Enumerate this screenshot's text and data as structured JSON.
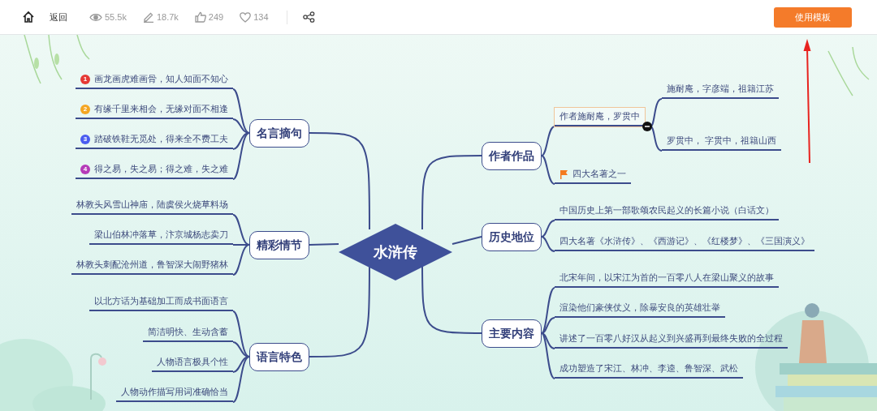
{
  "toolbar": {
    "back": "返回",
    "stats": [
      {
        "kind": "views",
        "value": "55.5k"
      },
      {
        "kind": "edits",
        "value": "18.7k"
      },
      {
        "kind": "likes",
        "value": "249"
      },
      {
        "kind": "favorites",
        "value": "134"
      }
    ],
    "button": "使用模板"
  },
  "mindmap": {
    "root": "水浒传",
    "branches": [
      {
        "title": "名言摘句",
        "children": [
          {
            "text": "画龙画虎难画骨，知人知面不知心",
            "marker": "1",
            "color": "#e53935",
            "selected": false
          },
          {
            "text": "有缘千里来相会，无缘对面不相逢",
            "marker": "2",
            "color": "#f5a623",
            "selected": false
          },
          {
            "text": "踏破铁鞋无觅处，得来全不费工夫",
            "marker": "3",
            "color": "#4a5cf0",
            "selected": false
          },
          {
            "text": "得之易，失之易；得之难，失之难",
            "marker": "4",
            "color": "#b53bb8",
            "selected": false
          }
        ]
      },
      {
        "title": "精彩情节",
        "children": [
          {
            "text": "林教头风雪山神庙，陆虞侯火烧草料场",
            "selected": false
          },
          {
            "text": "梁山伯林冲落草，汴京城杨志卖刀",
            "selected": false
          },
          {
            "text": "林教头刺配沧州道，鲁智深大闹野猪林",
            "selected": false
          }
        ]
      },
      {
        "title": "语言特色",
        "children": [
          {
            "text": "以北方话为基础加工而成书面语言",
            "selected": false
          },
          {
            "text": "简洁明快、生动含蓄",
            "selected": false
          },
          {
            "text": "人物语言极具个性",
            "selected": false
          },
          {
            "text": "人物动作描写用词准确恰当",
            "selected": false
          }
        ]
      },
      {
        "title": "作者作品",
        "children": [
          {
            "text": "作者施耐庵，罗贯中",
            "selected": true,
            "expanded": true,
            "children": [
              {
                "text": "施耐庵，字彦端，祖籍江苏",
                "selected": false
              },
              {
                "text": "罗贯中， 字贯中，祖籍山西",
                "selected": false
              }
            ]
          },
          {
            "text": "四大名著之一",
            "kind": "flag",
            "selected": false
          }
        ]
      },
      {
        "title": "历史地位",
        "children": [
          {
            "text": "中国历史上第一部歌颂农民起义的长篇小说（白话文）",
            "selected": false
          },
          {
            "text": "四大名著《水浒传》、《西游记》、《红楼梦》、《三国演义》",
            "selected": false
          }
        ]
      },
      {
        "title": "主要内容",
        "children": [
          {
            "text": "北宋年间，以宋江为首的一百零八人在梁山聚义的故事",
            "selected": false
          },
          {
            "text": "渲染他们豪侠仗义，除暴安良的英雄壮举",
            "selected": false
          },
          {
            "text": "讲述了一百零八好汉从起义到兴盛再到最终失败的全过程",
            "selected": false
          },
          {
            "text": "成功塑造了宋江、林冲、李逵、鲁智深、武松",
            "selected": false
          }
        ]
      }
    ]
  }
}
